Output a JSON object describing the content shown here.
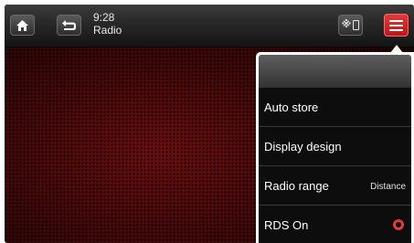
{
  "statusbar": {
    "time": "9:28",
    "source": "Radio",
    "icons": {
      "home": "home-icon",
      "back": "back-arrow-icon",
      "bluetooth_phone": "bluetooth-phone-icon",
      "menu": "hamburger-menu-icon"
    }
  },
  "menu": {
    "items": [
      {
        "label": "Auto store"
      },
      {
        "label": "Display design"
      },
      {
        "label": "Radio range",
        "value": "Distance"
      },
      {
        "label": "RDS On",
        "toggle_on": false
      }
    ]
  },
  "colors": {
    "accent": "#e03a3a",
    "background": "#4a0a0b",
    "menu_bg": "#0d0d0d"
  }
}
